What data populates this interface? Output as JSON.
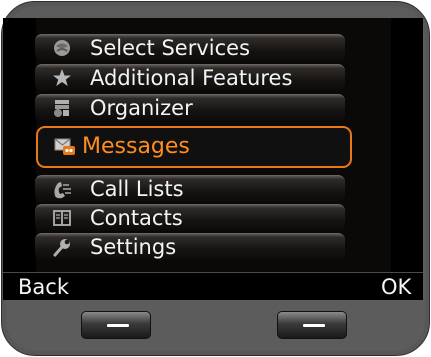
{
  "menu": {
    "items": [
      {
        "label": "Select Services",
        "icon": "select-services-icon"
      },
      {
        "label": "Additional Features",
        "icon": "star-icon"
      },
      {
        "label": "Organizer",
        "icon": "organizer-icon"
      },
      {
        "label": "Messages",
        "icon": "messages-icon",
        "selected": true
      },
      {
        "label": "Call Lists",
        "icon": "call-lists-icon"
      },
      {
        "label": "Contacts",
        "icon": "contacts-book-icon"
      },
      {
        "label": "Settings",
        "icon": "settings-wrench-icon"
      }
    ]
  },
  "softkeys": {
    "left": "Back",
    "right": "OK"
  },
  "colors": {
    "accent": "#e77a18",
    "selected_text": "#ff8c21",
    "text": "#f4f4f4",
    "background": "#000000",
    "bezel": "#575757"
  }
}
